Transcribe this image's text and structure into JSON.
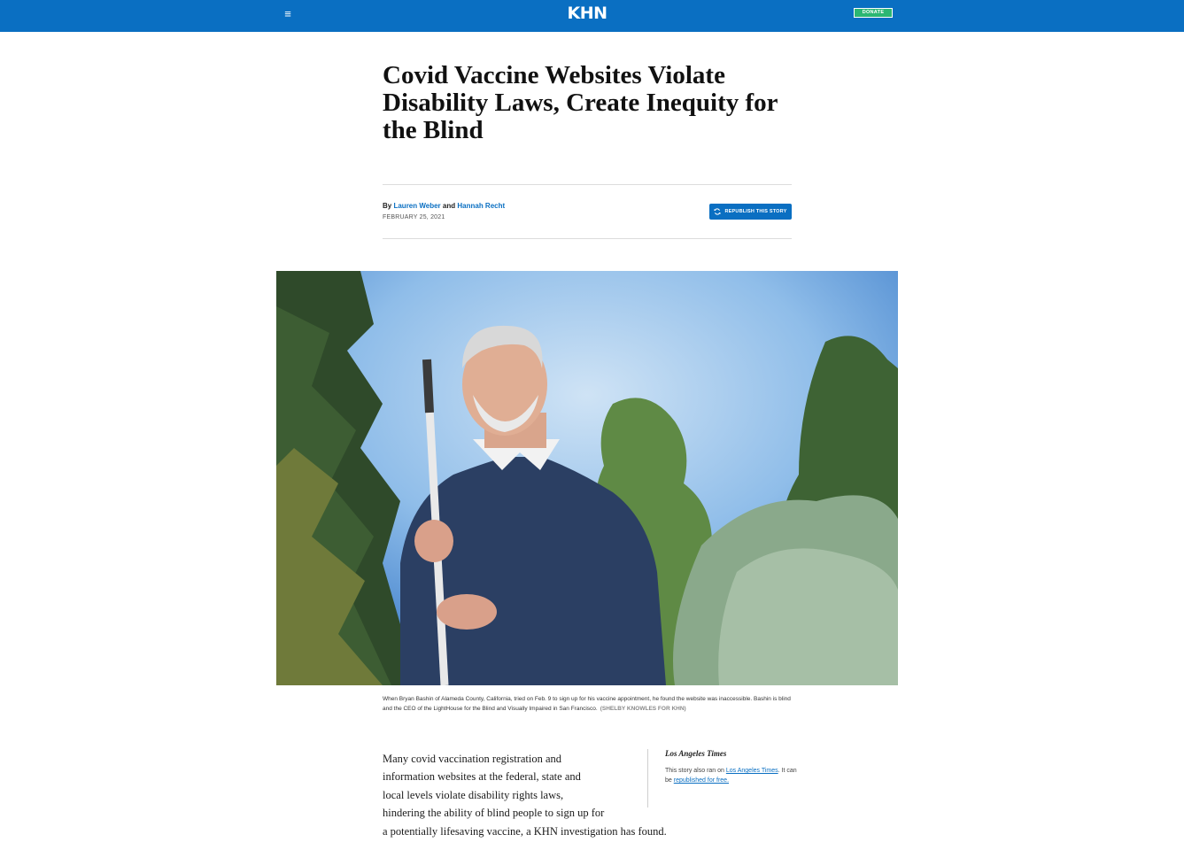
{
  "header": {
    "menu_icon": "hamburger-menu-icon",
    "logo": "KHN",
    "donate_label": "DONATE",
    "colors": {
      "bar": "#0a6fc2",
      "donate": "#2bb673"
    }
  },
  "article": {
    "title": "Covid Vaccine Websites Violate Disability Laws, Create Inequity for the Blind",
    "byline": {
      "prefix": "By",
      "author1": "Lauren Weber",
      "conjunction": "and",
      "author2": "Hannah Recht"
    },
    "date": "FEBRUARY 25, 2021",
    "republish_label": "REPUBLISH THIS STORY",
    "republish_icon": "refresh-icon",
    "photo": {
      "description_icon": "hero-photo",
      "caption": "When Bryan Bashin of Alameda County, California, tried on Feb. 9 to sign up for his vaccine appointment, he found the website was inaccessible. Bashin is blind and the CEO of the LightHouse for the Blind and Visually Impaired in San Francisco.",
      "credit": "(SHELBY KNOWLES FOR KHN)"
    },
    "lede": "Many covid vaccination registration and information websites at the federal, state and local levels violate disability rights laws, hindering the ability of blind people to sign up for a potentially lifesaving vaccine, a KHN investigation has found.",
    "lede_lines": [
      "Many covid vaccination registration and",
      "information websites at the federal, state and",
      "local levels violate disability rights laws,",
      "hindering the ability of blind people to sign up for",
      "a potentially lifesaving vaccine, a KHN investigation has found."
    ]
  },
  "aside": {
    "logo": "Los Angeles Times",
    "text_prefix": "This story also ran on",
    "link1": "Los Angeles Times",
    "text_mid": ". It can be",
    "link2": "republished for free."
  }
}
